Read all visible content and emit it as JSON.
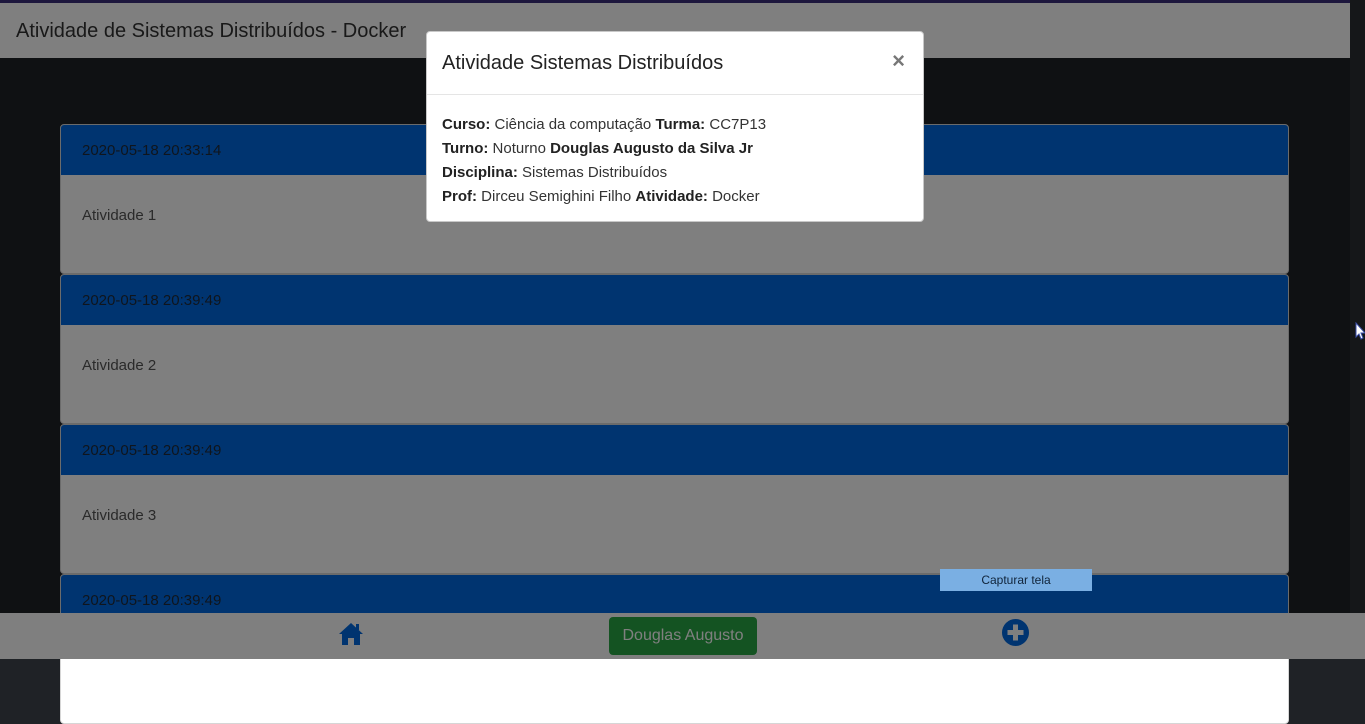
{
  "header": {
    "title": "Atividade de Sistemas Distribuídos - Docker"
  },
  "cards": [
    {
      "timestamp": "2020-05-18 20:33:14",
      "text": "Atividade 1"
    },
    {
      "timestamp": "2020-05-18 20:39:49",
      "text": "Atividade 2"
    },
    {
      "timestamp": "2020-05-18 20:39:49",
      "text": "Atividade 3"
    },
    {
      "timestamp": "2020-05-18 20:39:49",
      "text": ""
    }
  ],
  "footer": {
    "home_icon": "home-icon",
    "user_button": "Douglas Augusto",
    "add_icon": "plus-circle-icon"
  },
  "modal": {
    "title": "Atividade Sistemas Distribuídos",
    "close": "×",
    "curso_label": "Curso:",
    "curso": "Ciência da computação",
    "turma_label": "Turma:",
    "turma": "CC7P13",
    "turno_label": "Turno:",
    "turno": "Noturno",
    "aluno": "Douglas Augusto da Silva Jr",
    "disciplina_label": "Disciplina:",
    "disciplina": "Sistemas Distribuídos",
    "prof_label": "Prof:",
    "prof": "Dirceu Semighini Filho",
    "atividade_label": "Atividade:",
    "atividade": "Docker"
  },
  "capture_button": "Capturar tela",
  "colors": {
    "accent": "#0069e0",
    "success": "#28a745",
    "navbar_border": "#3a2f7a"
  }
}
